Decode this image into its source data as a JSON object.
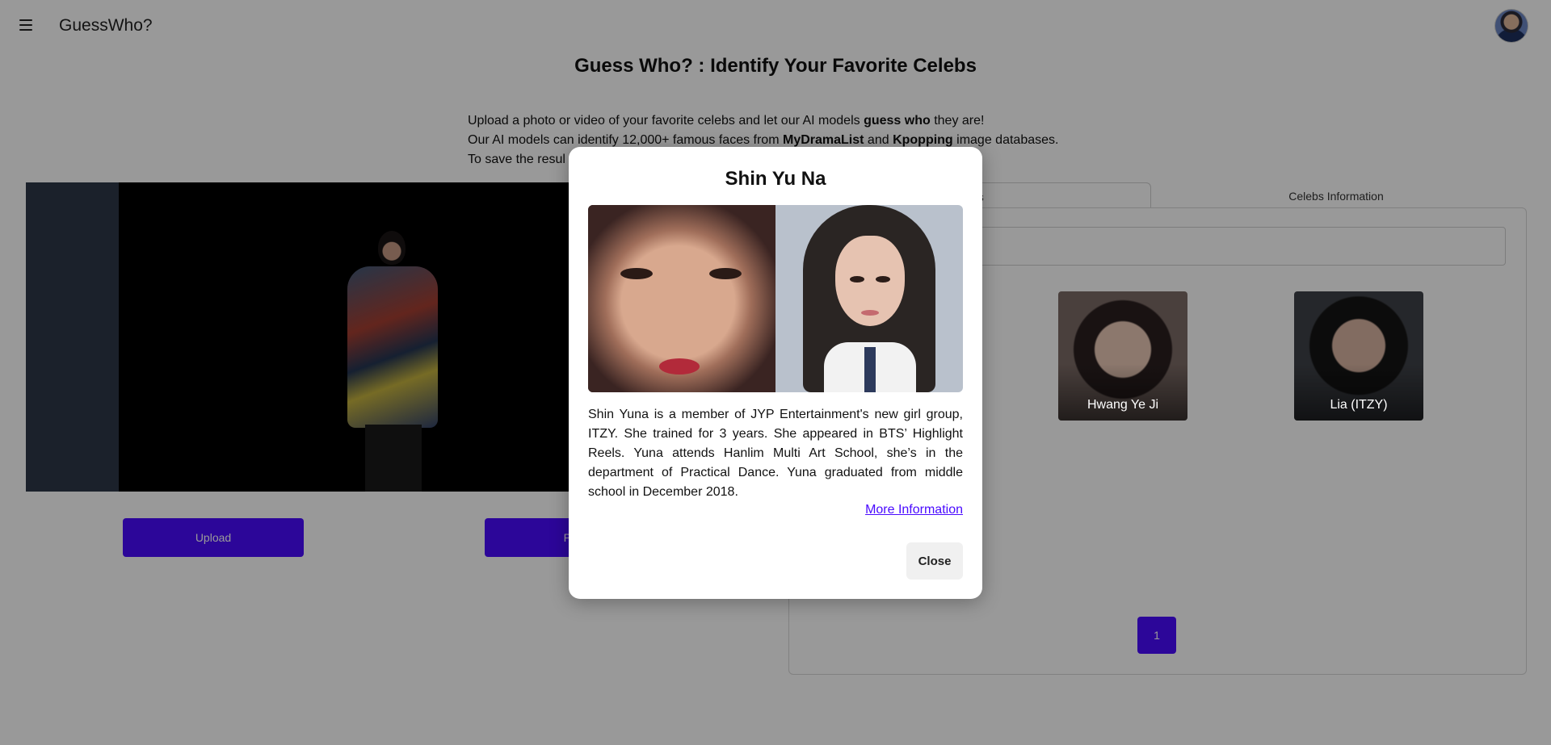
{
  "header": {
    "brand": "GuessWho?"
  },
  "page_title": "Guess Who? : Identify Your Favorite Celebs",
  "intro": {
    "line1_a": "Upload a photo or video of your favorite celebs and let our AI models ",
    "line1_b": "guess who",
    "line1_c": " they are!",
    "line2_a": "Our AI models can identify 12,000+ famous faces from ",
    "line2_b": "MyDramaList",
    "line2_c": " and ",
    "line2_d": "Kpopping",
    "line2_e": " image databases.",
    "line3": "To save the resul"
  },
  "actions": {
    "upload_label": "Upload",
    "process_label": "Proc"
  },
  "tabs": {
    "celebs_label": "elebs",
    "info_label": "Celebs Information"
  },
  "celebs": [
    {
      "name": "Hwang Ye Ji"
    },
    {
      "name": "Lia (ITZY)"
    }
  ],
  "pagination": {
    "current": "1"
  },
  "modal": {
    "title": "Shin Yu Na",
    "description": "Shin Yuna is a member of JYP Entertainment's new girl group, ITZY. She trained for 3 years. She appeared in BTS’ Highlight Reels. Yuna attends Hanlim Multi Art School, she’s in the department of Practical Dance. Yuna graduated from middle school in December 2018.",
    "more_link": "More Information",
    "close_label": "Close"
  },
  "colors": {
    "accent": "#4a0bff",
    "overlay": "rgba(0,0,0,0.40)"
  }
}
